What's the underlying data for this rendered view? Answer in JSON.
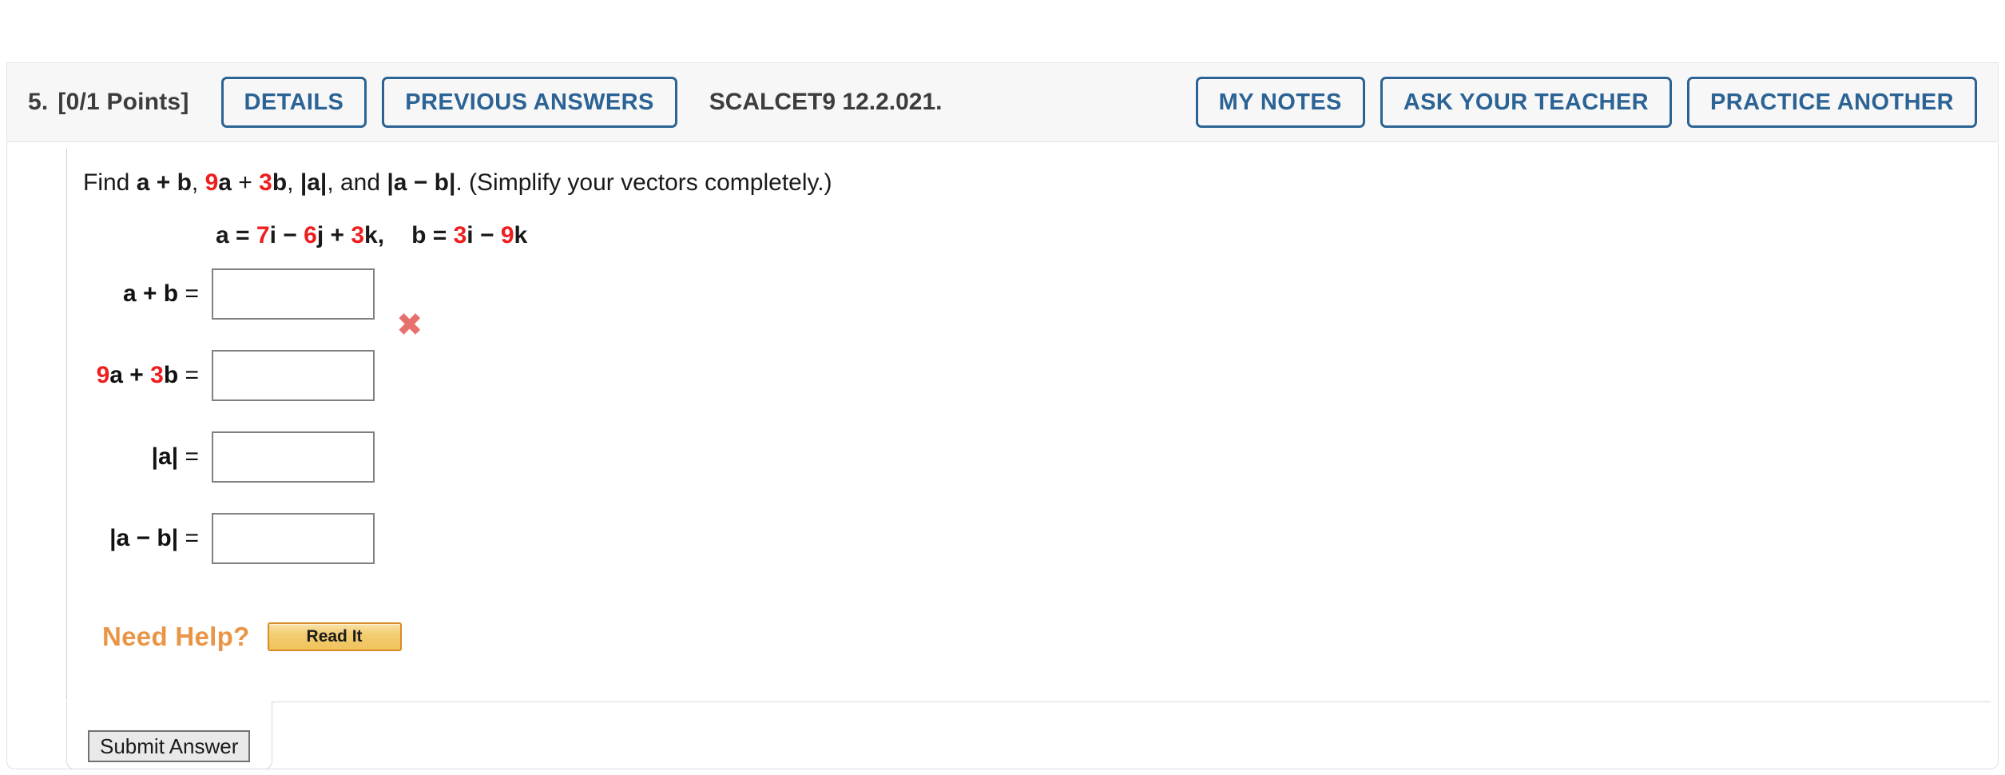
{
  "header": {
    "question_number": "5.",
    "points": "[0/1 Points]",
    "buttons_left": [
      {
        "name": "details-button",
        "label": "DETAILS"
      },
      {
        "name": "previous-answers-button",
        "label": "PREVIOUS ANSWERS"
      }
    ],
    "textbook_tag": "SCALCET9 12.2.021.",
    "buttons_right": [
      {
        "name": "my-notes-button",
        "label": "MY NOTES"
      },
      {
        "name": "ask-your-teacher-button",
        "label": "ASK YOUR TEACHER"
      },
      {
        "name": "practice-another-button",
        "label": "PRACTICE ANOTHER"
      }
    ]
  },
  "problem": {
    "prompt": {
      "lead": "Find ",
      "expr1": "a + b",
      "sep1": ", ",
      "coef_a": "9",
      "expr2_a": "a",
      "plus": " + ",
      "coef_b": "3",
      "expr2_b": "b",
      "sep2": ", ",
      "expr3": "|a|",
      "sep3": ", and ",
      "expr4": "|a − b|",
      "tail": ". (Simplify your vectors completely.)"
    },
    "vectors": {
      "a_name": "a",
      "a_eq": " = ",
      "a_c1": "7",
      "a_i": "i",
      "a_op1": " − ",
      "a_c2": "6",
      "a_j": "j",
      "a_op2": " + ",
      "a_c3": "3",
      "a_k": "k",
      "comma": ",",
      "b_name": "b",
      "b_eq": " = ",
      "b_c1": "3",
      "b_i": "i",
      "b_op1": " − ",
      "b_c2": "9",
      "b_k": "k"
    },
    "answers": [
      {
        "id": "a-plus-b",
        "label_parts": [
          {
            "text": "a + b",
            "red": false
          }
        ],
        "equals": "  =",
        "value": "",
        "mark": "✖",
        "mark_shown": true
      },
      {
        "id": "9a-plus-3b",
        "label_parts": [
          {
            "text": "9",
            "red": true
          },
          {
            "text": "a + ",
            "red": false
          },
          {
            "text": "3",
            "red": true
          },
          {
            "text": "b",
            "red": false
          }
        ],
        "equals": "  =",
        "value": "",
        "mark": "",
        "mark_shown": false
      },
      {
        "id": "magnitude-a",
        "label_parts": [
          {
            "text": "|a|",
            "red": false
          }
        ],
        "equals": "  =",
        "value": "",
        "mark": "",
        "mark_shown": false
      },
      {
        "id": "magnitude-a-minus-b",
        "label_parts": [
          {
            "text": "|a − b|",
            "red": false
          }
        ],
        "equals": "  =",
        "value": "",
        "mark": "",
        "mark_shown": false
      }
    ]
  },
  "help": {
    "label": "Need Help?",
    "read_it_label": "Read It"
  },
  "footer": {
    "submit_label": "Submit Answer"
  },
  "colors": {
    "accent_blue": "#2c6395",
    "red_value": "#ef1d1d",
    "incorrect_mark": "#e8706c",
    "need_help_orange": "#e99545",
    "read_it_border": "#d98b25",
    "header_bg": "#f7f7f7"
  }
}
